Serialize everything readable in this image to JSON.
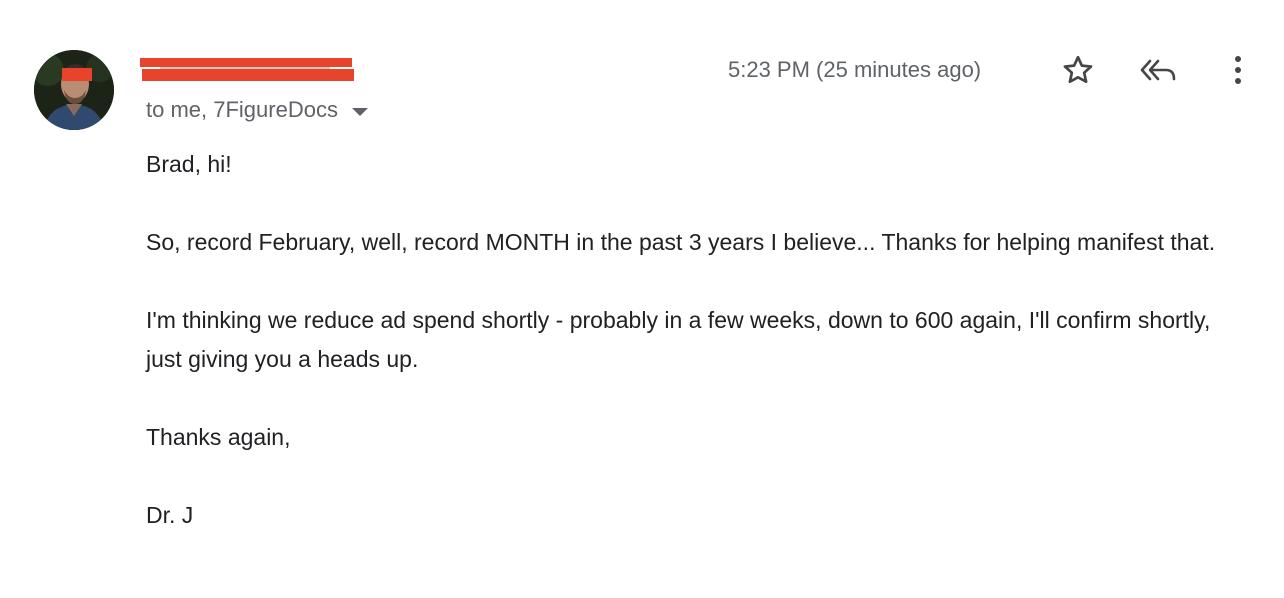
{
  "email": {
    "recipients_text": "to me, 7FigureDocs",
    "timestamp": "5:23 PM (25 minutes ago)",
    "body": {
      "greeting": "Brad, hi!",
      "paragraph1": "So, record February, well, record MONTH in the past 3 years I believe... Thanks for helping manifest that.",
      "paragraph2": "I'm thinking we reduce ad spend shortly - probably in a few weeks, down to 600 again, I'll confirm shortly, just giving you a heads up.",
      "closing": "Thanks again,",
      "signature": "Dr. J"
    }
  },
  "icons": {
    "star": "star-outline-icon",
    "reply_all": "reply-all-icon",
    "more": "more-vertical-icon",
    "caret": "caret-down-icon"
  },
  "colors": {
    "redaction": "#e8442c",
    "secondary_text": "#5f6368",
    "primary_text": "#202124"
  }
}
